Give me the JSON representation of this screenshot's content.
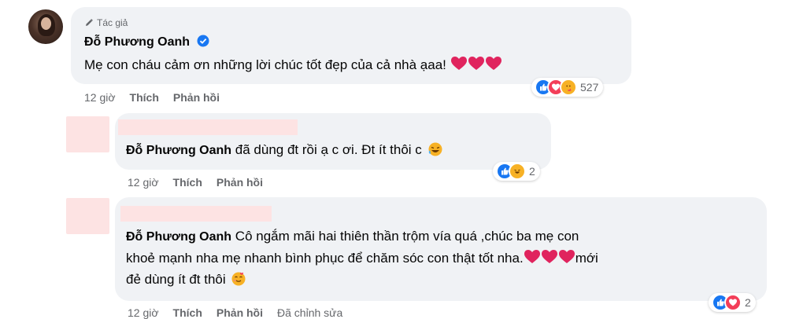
{
  "comments": [
    {
      "author_tag": "Tác giả",
      "author": "Đỗ Phương Oanh",
      "text": "Mẹ con cháu cảm ơn những lời chúc tốt đẹp của cả nhà ạaa!",
      "reaction_count": "527",
      "time": "12 giờ",
      "like": "Thích",
      "reply": "Phản hồi"
    },
    {
      "mention": "Đỗ Phương Oanh",
      "text": "đã dùng đt rồi ạ c ơi. Đt ít thôi c",
      "reaction_count": "2",
      "time": "12 giờ",
      "like": "Thích",
      "reply": "Phản hồi"
    },
    {
      "mention": "Đỗ Phương Oanh",
      "text_line1": "Cô ngắm mãi hai thiên thần trộm vía quá ,chúc ba mẹ con",
      "text_line2": "khoẻ mạnh nha mẹ nhanh bình phục để chăm sóc con thật tốt nha.",
      "text_line2_tail": "mới",
      "text_line3": "đẻ dùng ít đt thôi",
      "reaction_count": "2",
      "time": "12 giờ",
      "like": "Thích",
      "reply": "Phản hồi",
      "edited": "Đã chỉnh sửa"
    }
  ],
  "icons": [
    "pencil-icon",
    "verified-icon",
    "heart-icon",
    "like-reaction-icon",
    "love-reaction-icon",
    "care-reaction-icon",
    "haha-reaction-icon",
    "laugh-emoji",
    "hug-emoji"
  ],
  "colors": {
    "bubble": "#f0f2f5",
    "link": "#65676b",
    "like": "#1877f2",
    "love": "#f33e58",
    "redacted": "#fde3e3"
  }
}
